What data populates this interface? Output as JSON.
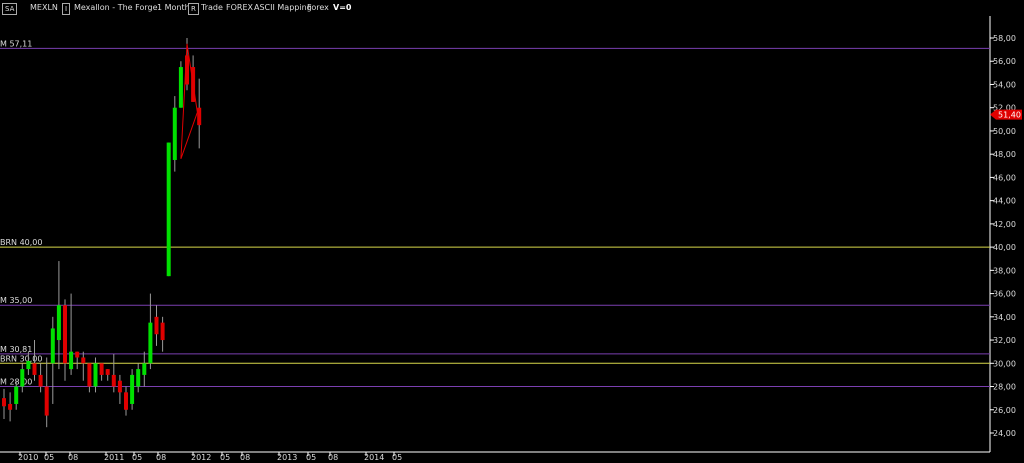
{
  "header": {
    "symbol_box": "SA",
    "symbol": "MEXLN",
    "indicator_box": "I",
    "title": "Mexallon - The Forge",
    "timeframe": "1 Month",
    "r_box": "R",
    "mode": "Trade",
    "market": "FOREX",
    "feed": "ASCII Mapping",
    "category": "Forex",
    "volume": "V=0"
  },
  "colors": {
    "background": "#000000",
    "up_candle": "#00e000",
    "down_candle": "#e00000",
    "axis": "#ffffff",
    "purple_line": "#7a3fb0",
    "yellow_line": "#d8d84a",
    "price_tag": "#e00000",
    "triangle": "#e00000"
  },
  "chart_data": {
    "type": "candlestick",
    "y_axis": {
      "min": 23.0,
      "max": 60.0,
      "ticks": [
        "24,00",
        "26,00",
        "28,00",
        "30,00",
        "32,00",
        "34,00",
        "36,00",
        "38,00",
        "40,00",
        "42,00",
        "44,00",
        "46,00",
        "48,00",
        "50,00",
        "52,00",
        "54,00",
        "56,00",
        "58,00"
      ]
    },
    "x_axis": {
      "labels": [
        "2010",
        "05",
        "08",
        "2011",
        "05",
        "08",
        "2012",
        "05",
        "08",
        "2013",
        "05",
        "08",
        "2014",
        "05"
      ]
    },
    "current_price": "51,40",
    "horizontal_levels": [
      {
        "label": "M 57,11",
        "value": 57.11,
        "color": "purple"
      },
      {
        "label": "BRN 40,00",
        "value": 40.0,
        "color": "yellow"
      },
      {
        "label": "M 35,00",
        "value": 35.0,
        "color": "purple"
      },
      {
        "label": "M 30,81",
        "value": 30.81,
        "color": "purple"
      },
      {
        "label": "BRN 30,00",
        "value": 30.0,
        "color": "yellow"
      },
      {
        "label": "M 28,00",
        "value": 28.0,
        "color": "purple"
      }
    ],
    "candles": [
      [
        27.0,
        27.8,
        25.2,
        26.3
      ],
      [
        26.5,
        27.5,
        25.0,
        26.0
      ],
      [
        26.5,
        28.5,
        26.0,
        28.0
      ],
      [
        28.0,
        30.0,
        27.5,
        29.5
      ],
      [
        29.5,
        31.0,
        29.0,
        30.2
      ],
      [
        30.0,
        32.0,
        28.5,
        29.0
      ],
      [
        29.0,
        30.0,
        27.5,
        28.0
      ],
      [
        28.0,
        30.5,
        24.5,
        25.5
      ],
      [
        30.0,
        34.0,
        26.5,
        33.0
      ],
      [
        32.0,
        38.8,
        29.5,
        35.0
      ],
      [
        35.0,
        35.5,
        28.5,
        30.0
      ],
      [
        29.5,
        36.0,
        29.0,
        31.0
      ],
      [
        31.0,
        31.0,
        29.5,
        30.5
      ],
      [
        30.5,
        31.0,
        28.5,
        30.0
      ],
      [
        30.0,
        30.0,
        27.5,
        28.0
      ],
      [
        28.0,
        30.5,
        27.5,
        30.0
      ],
      [
        30.0,
        30.0,
        28.5,
        29.0
      ],
      [
        29.5,
        29.5,
        28.5,
        29.0
      ],
      [
        29.0,
        30.8,
        27.5,
        28.0
      ],
      [
        28.5,
        29.0,
        26.5,
        27.5
      ],
      [
        27.5,
        28.0,
        25.5,
        26.0
      ],
      [
        26.5,
        29.5,
        26.0,
        29.0
      ],
      [
        28.0,
        30.0,
        27.5,
        29.5
      ],
      [
        29.0,
        31.0,
        28.0,
        30.0
      ],
      [
        30.0,
        36.0,
        29.5,
        33.5
      ],
      [
        34.0,
        35.0,
        31.5,
        32.5
      ],
      [
        33.5,
        34.0,
        31.0,
        32.0
      ],
      [
        37.5,
        49.0,
        37.5,
        49.0
      ],
      [
        47.5,
        53.0,
        46.5,
        52.0
      ],
      [
        52.0,
        56.0,
        52.0,
        55.5
      ],
      [
        56.5,
        58.0,
        53.5,
        54.0
      ],
      [
        55.5,
        56.5,
        52.5,
        52.5
      ],
      [
        52.0,
        54.5,
        48.5,
        50.5
      ]
    ],
    "annotation": {
      "type": "triangle",
      "points": [
        [
          1.0,
          57.5
        ],
        [
          2.7,
          51.6
        ],
        [
          0.0,
          47.6
        ]
      ]
    }
  }
}
